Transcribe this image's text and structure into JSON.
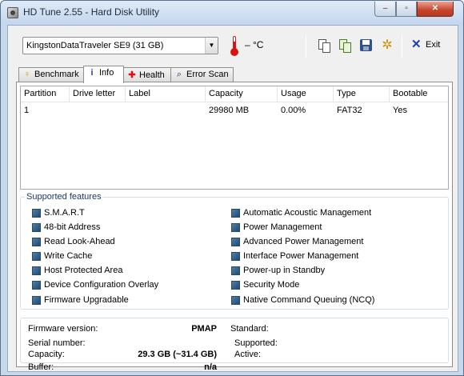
{
  "window": {
    "title": "HD Tune 2.55 - Hard Disk Utility",
    "controls": {
      "minimize": "–",
      "maximize": "▫",
      "close": "✕"
    }
  },
  "toolbar": {
    "drive": "KingstonDataTraveler SE9 (31 GB)",
    "temperature": "– °C",
    "exit_label": "Exit",
    "icons": [
      "copy-info-icon",
      "copy-screenshot-icon",
      "save-icon",
      "options-icon",
      "exit-icon"
    ]
  },
  "tabs": [
    {
      "label": "Benchmark",
      "icon": "benchmark-icon"
    },
    {
      "label": "Info",
      "icon": "info-icon",
      "active": true
    },
    {
      "label": "Health",
      "icon": "health-icon"
    },
    {
      "label": "Error Scan",
      "icon": "error-scan-icon"
    }
  ],
  "partition_table": {
    "columns": [
      "Partition",
      "Drive letter",
      "Label",
      "Capacity",
      "Usage",
      "Type",
      "Bootable"
    ],
    "rows": [
      [
        "1",
        "",
        "",
        "29980 MB",
        "0.00%",
        "FAT32",
        "Yes"
      ]
    ]
  },
  "features": {
    "title": "Supported features",
    "left": [
      "S.M.A.R.T",
      "48-bit Address",
      "Read Look-Ahead",
      "Write Cache",
      "Host Protected Area",
      "Device Configuration Overlay",
      "Firmware Upgradable"
    ],
    "right": [
      "Automatic Acoustic Management",
      "Power Management",
      "Advanced Power Management",
      "Interface Power Management",
      "Power-up in Standby",
      "Security Mode",
      "Native Command Queuing (NCQ)"
    ]
  },
  "info": {
    "firmware_label": "Firmware version:",
    "firmware_value": "PMAP",
    "serial_label": "Serial number:",
    "serial_value": "",
    "capacity_label": "Capacity:",
    "capacity_value": "29.3 GB (~31.4 GB)",
    "buffer_label": "Buffer:",
    "buffer_value": "n/a",
    "standard_label": "Standard:",
    "supported_label": "Supported:",
    "active_label": "Active:"
  },
  "colors": {
    "titlebar": "#c7d8ec",
    "checkbox": "#2f5f8a",
    "close_button": "#c7432b"
  }
}
